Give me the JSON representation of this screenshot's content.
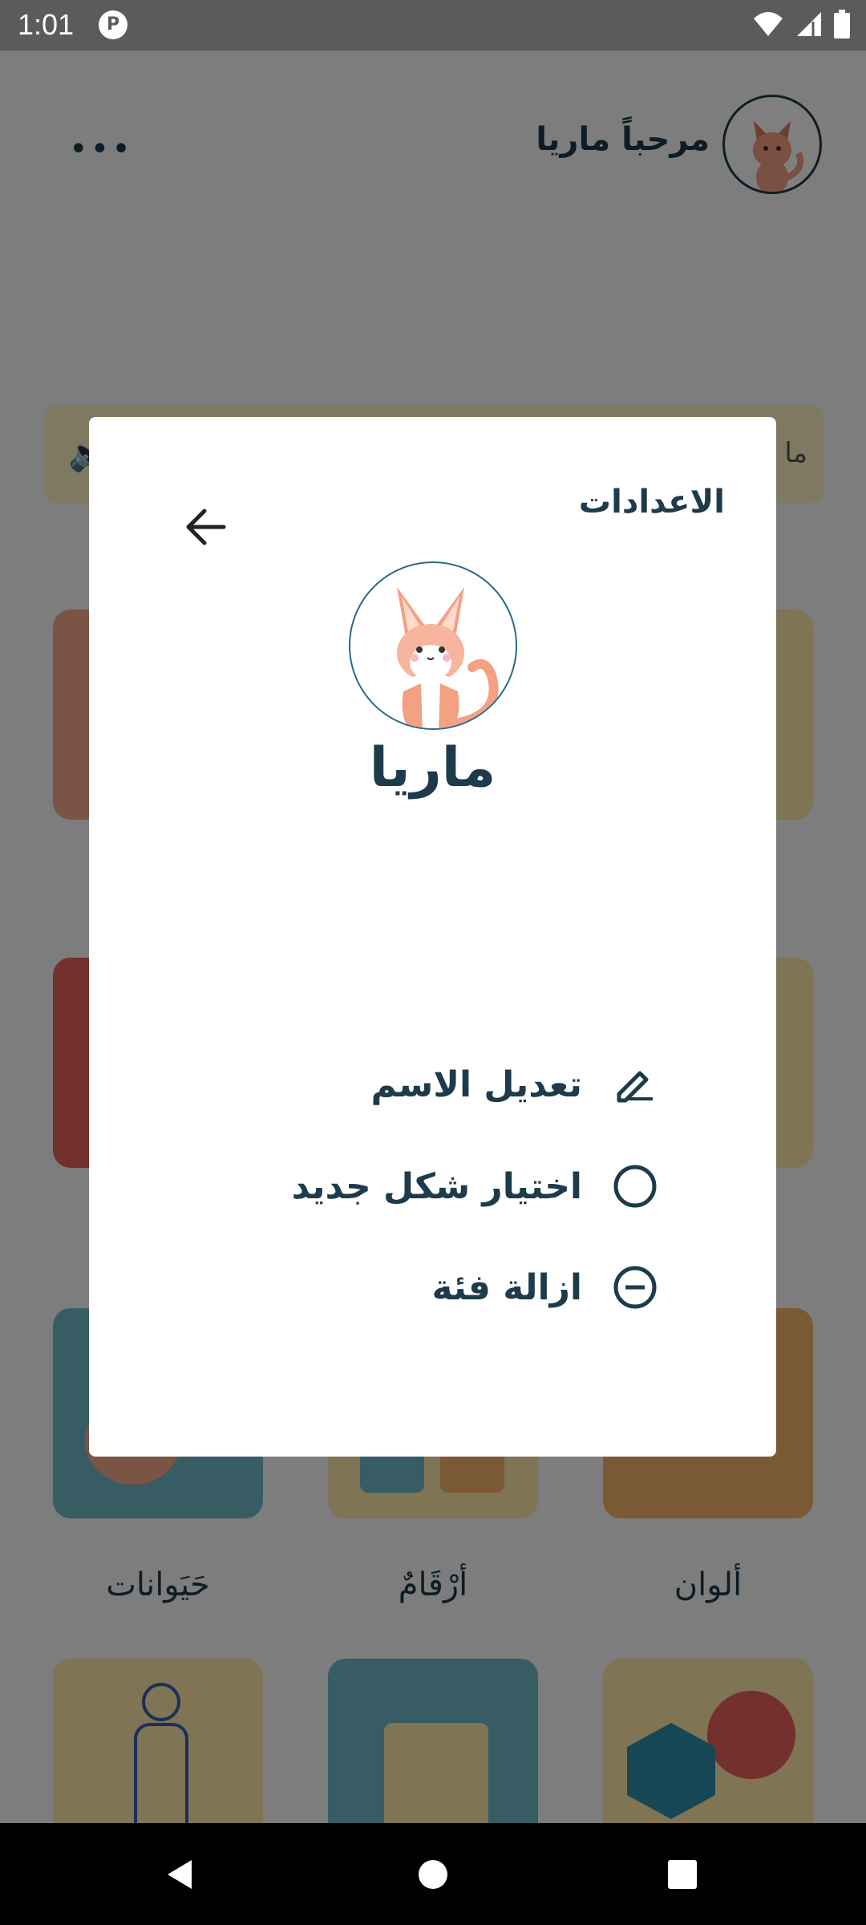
{
  "status_bar": {
    "time": "1:01"
  },
  "header": {
    "greeting": "مرحباً ماريا",
    "menu_glyph": "•••"
  },
  "banner": {
    "text": "ما"
  },
  "categories": [
    {
      "label": "ألوان"
    },
    {
      "label": "أرْقَامٌ"
    },
    {
      "label": "حَيَوانات"
    }
  ],
  "dialog": {
    "title": "الاعدادات",
    "profile_name": "ماريا",
    "options": [
      {
        "label": "تعديل الاسم",
        "icon": "edit-icon"
      },
      {
        "label": "اختيار شكل جديد",
        "icon": "circle-icon"
      },
      {
        "label": "ازالة فئة",
        "icon": "remove-circle-icon"
      }
    ]
  },
  "colors": {
    "text_primary": "#1d3b4a",
    "tile_coral": "#f5a88a",
    "tile_yellow": "#ffe9a8",
    "tile_teal": "#6fb8c9",
    "tile_orange": "#f5b26b",
    "tile_red": "#e6605a"
  }
}
